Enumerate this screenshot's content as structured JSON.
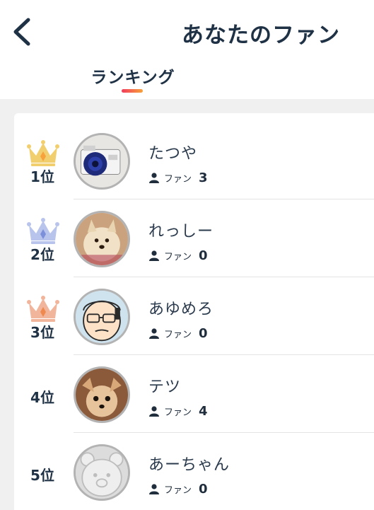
{
  "header": {
    "title": "あなたのファン",
    "back_icon": "chevron-left-icon"
  },
  "tabs": [
    {
      "label": "ランキング",
      "active": true
    }
  ],
  "colors": {
    "tab_underline_start": "#f23b5c",
    "tab_underline_end": "#f7a23a",
    "text": "#1f3145",
    "background": "#f0f0f0",
    "crown_gold": "#f2cf6e",
    "crown_silver": "#b9c4ec",
    "crown_bronze": "#f1b59b"
  },
  "ranking": [
    {
      "rank": "1位",
      "crown": "gold-crown-icon",
      "name": "たつや",
      "fan_label": "ファン",
      "fan_count": "3",
      "avatar": "camera-photo"
    },
    {
      "rank": "2位",
      "crown": "silver-crown-icon",
      "name": "れっしー",
      "fan_label": "ファン",
      "fan_count": "0",
      "avatar": "dog-photo"
    },
    {
      "rank": "3位",
      "crown": "bronze-crown-icon",
      "name": "あゆめろ",
      "fan_label": "ファン",
      "fan_count": "0",
      "avatar": "man-illustration"
    },
    {
      "rank": "4位",
      "crown": "",
      "name": "テツ",
      "fan_label": "ファン",
      "fan_count": "4",
      "avatar": "chihuahua-photo"
    },
    {
      "rank": "5位",
      "crown": "",
      "name": "あーちゃん",
      "fan_label": "ファン",
      "fan_count": "0",
      "avatar": "default-bear-avatar"
    }
  ]
}
